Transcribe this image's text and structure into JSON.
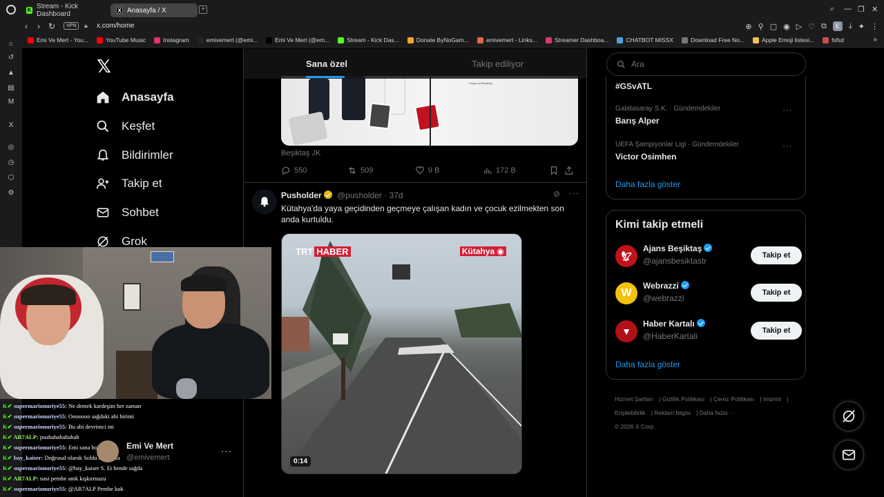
{
  "browser": {
    "tabs": [
      {
        "label": "Stream - Kick Dashboard"
      },
      {
        "label": "Anasayfa / X"
      }
    ],
    "vpn_label": "VPN",
    "url": "x.com/home",
    "bookmarks": [
      {
        "label": "Emi Ve Mert - You...",
        "color": "#ff0000"
      },
      {
        "label": "YouTube Music",
        "color": "#ff0000"
      },
      {
        "label": "Instagram",
        "color": "#e1306c"
      },
      {
        "label": "emivemert (@emi...",
        "color": "#222222"
      },
      {
        "label": "Emi Ve Mert (@em...",
        "color": "#000000"
      },
      {
        "label": "Stream - Kick Das...",
        "color": "#53fc18"
      },
      {
        "label": "Donate ByNoGam...",
        "color": "#f5a623"
      },
      {
        "label": "emivemert - Links...",
        "color": "#e06b3c"
      },
      {
        "label": "Streamer Dashboa...",
        "color": "#d93a6a"
      },
      {
        "label": "CHATBOT MISSX",
        "color": "#4aa3df"
      },
      {
        "label": "Download Free No...",
        "color": "#777777"
      },
      {
        "label": "Apple Emoji listesi...",
        "color": "#f2c14e"
      },
      {
        "label": "fsfsd",
        "color": "#c94f4f"
      }
    ]
  },
  "x_nav": {
    "items": [
      {
        "label": "Anasayfa",
        "icon": "home-icon"
      },
      {
        "label": "Keşfet",
        "icon": "search-icon"
      },
      {
        "label": "Bildirimler",
        "icon": "bell-icon"
      },
      {
        "label": "Takip et",
        "icon": "follow-icon"
      },
      {
        "label": "Sohbet",
        "icon": "mail-icon"
      },
      {
        "label": "Grok",
        "icon": "grok-icon"
      }
    ]
  },
  "feed": {
    "tabs": [
      {
        "label": "Sana özel"
      },
      {
        "label": "Takip ediliyor"
      }
    ],
    "post1": {
      "image_caption": "Hoşça kal Beşiktaş",
      "source": "Beşiktaş JK",
      "replies": "550",
      "reposts": "509",
      "likes": "9 B",
      "views": "172 B"
    },
    "post2": {
      "name": "Pusholder",
      "handle": "@pusholder · 37d",
      "text": "Kütahya'da yaya geçidinden geçmeye çalışan kadın ve çocuk ezilmekten son anda kurtuldu.",
      "video": {
        "channel_prefix": "TRT",
        "channel": "HABER",
        "location": "Kütahya",
        "duration": "0:14"
      }
    }
  },
  "right": {
    "search_placeholder": "Ara",
    "trends": [
      {
        "meta": "",
        "name": "#GSvATL"
      },
      {
        "meta": "Galatasaray S.K. · Gündemdekiler",
        "name": "Barış Alper"
      },
      {
        "meta": "UEFA Şampiyonlar Ligi · Gündemdekiler",
        "name": "Victor Osimhen"
      }
    ],
    "show_more": "Daha fazla göster",
    "who_to_follow": {
      "title": "Kimi takip etmeli",
      "accounts": [
        {
          "name": "Ajans Beşiktaş",
          "handle": "@ajansbesiktastr",
          "button": "Takip et",
          "avatar_color": "#c0121b"
        },
        {
          "name": "Webrazzi",
          "handle": "@webrazzi",
          "button": "Takip et",
          "avatar_color": "#f4c20d"
        },
        {
          "name": "Haber Kartalı",
          "handle": "@HaberKartali",
          "button": "Takip et",
          "avatar_color": "#b01018"
        }
      ],
      "show_more": "Daha fazla göster"
    },
    "footer": [
      "Hizmet Şartları",
      "Gizlilik Politikası",
      "Çerez Politikası",
      "Imprint",
      "Erişilebilirlik",
      "Reklam bilgisi",
      "Daha fazla ···",
      "© 2026 X Corp."
    ]
  },
  "stream": {
    "chat": [
      {
        "user": "supermarionuriye55:",
        "msg": "Ne demek kardeşim her zaman",
        "green": false
      },
      {
        "user": "supermarionuriye55:",
        "msg": "Ooooooo sağdaki abi birimi",
        "green": false
      },
      {
        "user": "supermarionuriye55:",
        "msg": "Bu abi devrimci mi",
        "green": false
      },
      {
        "user": "AR7ALP:",
        "msg": "puahahahahahah",
        "green": true
      },
      {
        "user": "supermarionuriye55:",
        "msg": "Emi sana bolsu baba",
        "green": false
      },
      {
        "user": "bay_kaiser:",
        "msg": "Doğrusal olarak Solda kalmakta",
        "green": false
      },
      {
        "user": "supermarionuriye55:",
        "msg": "@bay_kaiser S. Et bende sağda",
        "green": false
      },
      {
        "user": "AR7ALP:",
        "msg": "nasi pembe amk kışkırmuzu",
        "green": true
      },
      {
        "user": "supermarionuriye55:",
        "msg": "@AR7ALP Pembe kuk",
        "green": false
      }
    ],
    "account": {
      "name": "Emi Ve Mert",
      "handle": "@emivemert"
    }
  }
}
